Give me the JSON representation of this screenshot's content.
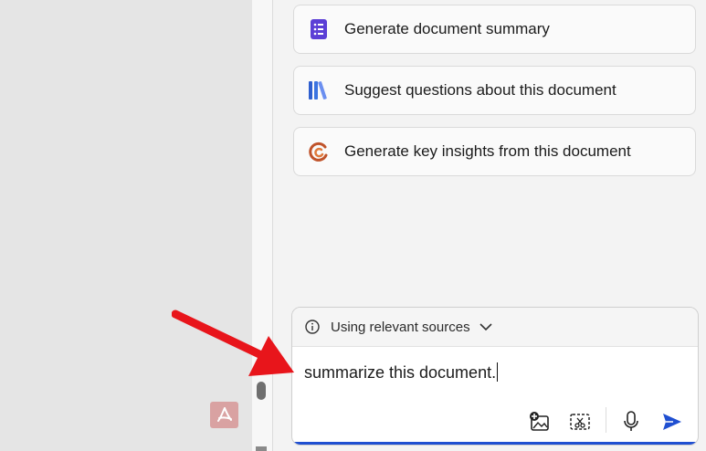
{
  "suggestions": [
    {
      "label": "Generate document summary",
      "icon": "list-document-icon"
    },
    {
      "label": "Suggest questions about this document",
      "icon": "books-icon"
    },
    {
      "label": "Generate key insights from this document",
      "icon": "insights-swirl-icon"
    }
  ],
  "composer": {
    "sources_label": "Using relevant sources",
    "input_value": "summarize this document.",
    "tools": [
      "add-image-icon",
      "screenshot-clip-icon",
      "microphone-icon",
      "send-icon"
    ]
  },
  "colors": {
    "accent_blue": "#1f4fd1",
    "arrow_red": "#e8151b",
    "summary_purple": "#5b3fd6",
    "books_blue": "#3b74e0",
    "insights_orange": "#c0532a"
  }
}
